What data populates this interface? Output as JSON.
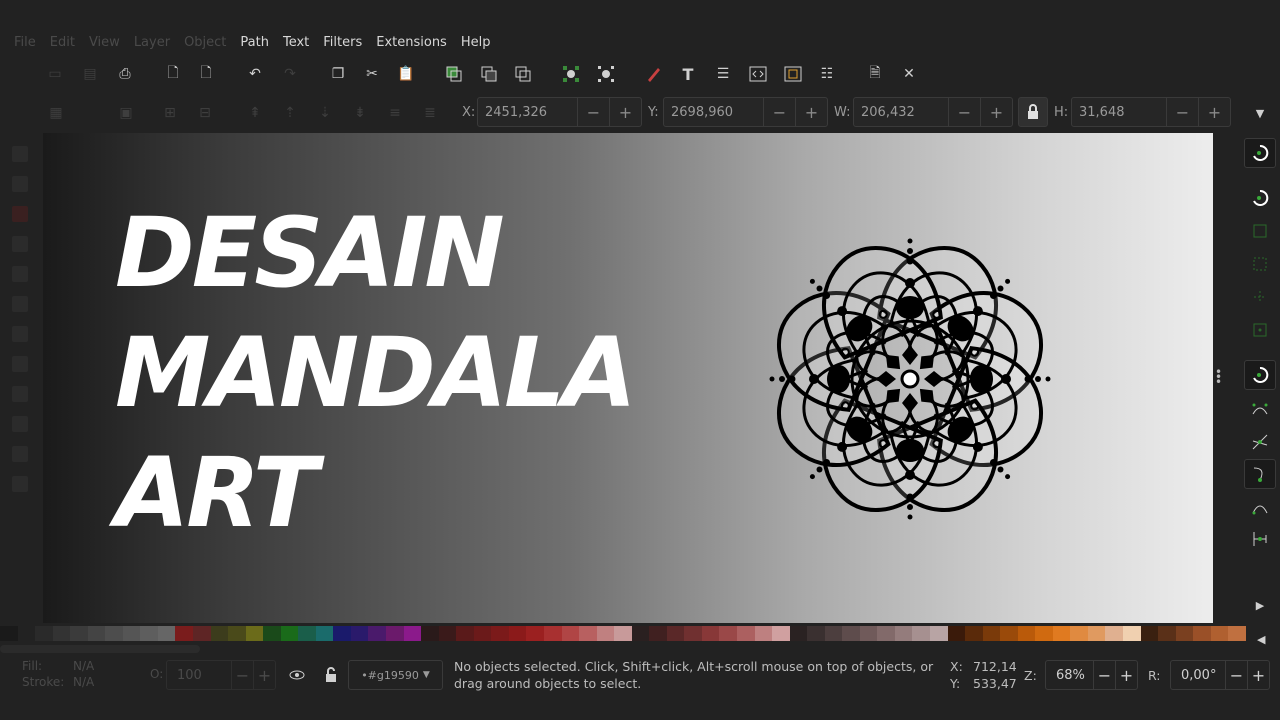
{
  "menu": {
    "items": [
      {
        "label": "File",
        "dim": true
      },
      {
        "label": "Edit",
        "dim": true
      },
      {
        "label": "View",
        "dim": true
      },
      {
        "label": "Layer",
        "dim": true
      },
      {
        "label": "Object",
        "dim": true
      },
      {
        "label": "Path",
        "dim": false
      },
      {
        "label": "Text",
        "dim": false
      },
      {
        "label": "Filters",
        "dim": false
      },
      {
        "label": "Extensions",
        "dim": false
      },
      {
        "label": "Help",
        "dim": false
      }
    ]
  },
  "controls": {
    "x_label": "X:",
    "x_value": "2451,326",
    "y_label": "Y:",
    "y_value": "2698,960",
    "w_label": "W:",
    "w_value": "206,432",
    "h_label": "H:",
    "h_value": "31,648",
    "minus": "−",
    "plus": "+"
  },
  "canvas": {
    "line1": "DESAIN",
    "line2": "MANDALA",
    "line3": "ART"
  },
  "status": {
    "fill_label": "Fill:",
    "stroke_label": "Stroke:",
    "fill_value": "N/A",
    "stroke_value": "N/A",
    "opacity_label": "O:",
    "opacity_value": "100",
    "layer": "•#g19590",
    "message_line1": "No objects selected. Click, Shift+click, Alt+scroll mouse on top of objects, or",
    "message_line2": "drag around objects to select.",
    "cursor_x_label": "X:",
    "cursor_x": "712,14",
    "cursor_y_label": "Y:",
    "cursor_y": "533,47",
    "zoom_label": "Z:",
    "zoom": "68%",
    "rotation_label": "R:",
    "rotation": "0,00°"
  },
  "palette": [
    "#1a1a1a",
    "#222222",
    "#2a2a2a",
    "#333333",
    "#3b3b3b",
    "#444444",
    "#4d4d4d",
    "#555555",
    "#5e5e5e",
    "#666666",
    "#7a1c1c",
    "#5e2525",
    "#3c3c1c",
    "#4a4a1a",
    "#6b6b1a",
    "#1a4a1a",
    "#1a6b1a",
    "#1a5e4a",
    "#1a6b6b",
    "#1a1a6b",
    "#2a1a6b",
    "#4a1a6b",
    "#6b1a6b",
    "#8b1a8b",
    "#2a1a1a",
    "#3a1a1a",
    "#5a1a1a",
    "#6b1a1a",
    "#7b1a1a",
    "#8b1a1a",
    "#9b2020",
    "#a83030",
    "#b04545",
    "#b86060",
    "#c08080",
    "#c89a9a",
    "#2a2020",
    "#402020",
    "#5a2828",
    "#703030",
    "#883838",
    "#9a4848",
    "#ac6060",
    "#be8080",
    "#d0a0a0",
    "#2a2222",
    "#3a3030",
    "#4c3e3e",
    "#5e4c4c",
    "#705a5a",
    "#826a6a",
    "#947c7c",
    "#a69090",
    "#b8a4a4",
    "#3a1a0a",
    "#5a2a0a",
    "#7a3a0a",
    "#9a4a0a",
    "#ba5a0a",
    "#d06a10",
    "#e07a20",
    "#e08a40",
    "#e09a60",
    "#e0b090",
    "#f0d0b0",
    "#3a2010",
    "#5a3018",
    "#7a4020",
    "#9a5028",
    "#b06030",
    "#c07040"
  ]
}
